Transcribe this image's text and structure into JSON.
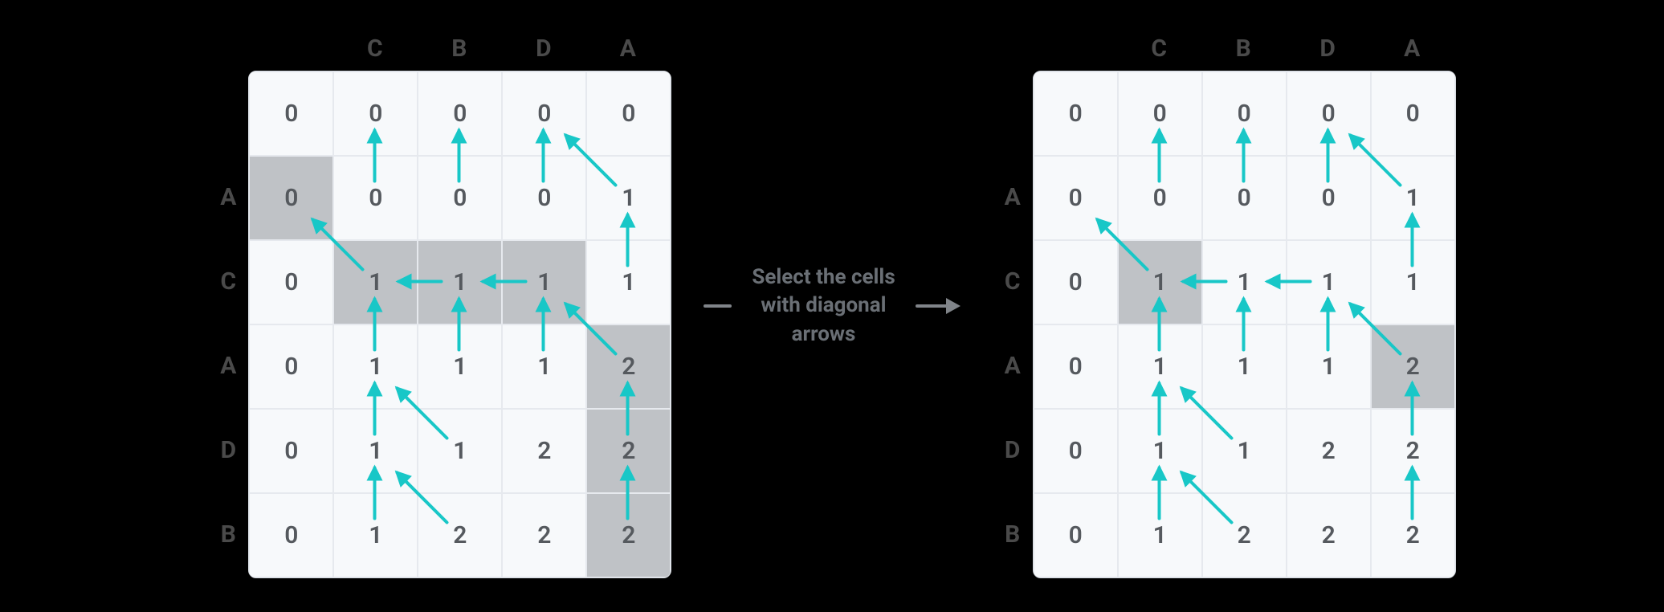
{
  "colHeaders": [
    "",
    "C",
    "B",
    "D",
    "A"
  ],
  "rowHeaders": [
    "",
    "A",
    "C",
    "A",
    "D",
    "B"
  ],
  "arrowColor": "#18c7c7",
  "middle": {
    "line1": "Select the cells",
    "line2": "with diagonal",
    "line3": "arrows"
  },
  "left": {
    "cells": [
      [
        {
          "v": "0"
        },
        {
          "v": "0"
        },
        {
          "v": "0"
        },
        {
          "v": "0"
        },
        {
          "v": "0"
        }
      ],
      [
        {
          "v": "0",
          "hl": true
        },
        {
          "v": "0"
        },
        {
          "v": "0"
        },
        {
          "v": "0"
        },
        {
          "v": "1"
        }
      ],
      [
        {
          "v": "0"
        },
        {
          "v": "1",
          "hl": true
        },
        {
          "v": "1",
          "hl": true
        },
        {
          "v": "1",
          "hl": true
        },
        {
          "v": "1"
        }
      ],
      [
        {
          "v": "0"
        },
        {
          "v": "1"
        },
        {
          "v": "1"
        },
        {
          "v": "1"
        },
        {
          "v": "2",
          "hl": true
        }
      ],
      [
        {
          "v": "0"
        },
        {
          "v": "1"
        },
        {
          "v": "1"
        },
        {
          "v": "2"
        },
        {
          "v": "2",
          "hl": true
        }
      ],
      [
        {
          "v": "0"
        },
        {
          "v": "1"
        },
        {
          "v": "2"
        },
        {
          "v": "2"
        },
        {
          "v": "2",
          "hl": true
        }
      ]
    ],
    "arrows": [
      {
        "type": "up",
        "r": 1,
        "c": 1
      },
      {
        "type": "up",
        "r": 1,
        "c": 2
      },
      {
        "type": "up",
        "r": 1,
        "c": 3
      },
      {
        "type": "diag",
        "r": 1,
        "c": 4
      },
      {
        "type": "diag",
        "r": 2,
        "c": 1
      },
      {
        "type": "left",
        "r": 2,
        "c": 2
      },
      {
        "type": "left",
        "r": 2,
        "c": 3
      },
      {
        "type": "up",
        "r": 2,
        "c": 4
      },
      {
        "type": "up",
        "r": 3,
        "c": 1
      },
      {
        "type": "up",
        "r": 3,
        "c": 2
      },
      {
        "type": "up",
        "r": 3,
        "c": 3
      },
      {
        "type": "diag",
        "r": 3,
        "c": 4
      },
      {
        "type": "up",
        "r": 4,
        "c": 1
      },
      {
        "type": "diag",
        "r": 4,
        "c": 2
      },
      {
        "type": "up",
        "r": 4,
        "c": 4
      },
      {
        "type": "up",
        "r": 5,
        "c": 1
      },
      {
        "type": "diag",
        "r": 5,
        "c": 2
      },
      {
        "type": "up",
        "r": 5,
        "c": 4
      }
    ]
  },
  "right": {
    "cells": [
      [
        {
          "v": "0"
        },
        {
          "v": "0"
        },
        {
          "v": "0"
        },
        {
          "v": "0"
        },
        {
          "v": "0"
        }
      ],
      [
        {
          "v": "0"
        },
        {
          "v": "0"
        },
        {
          "v": "0"
        },
        {
          "v": "0"
        },
        {
          "v": "1"
        }
      ],
      [
        {
          "v": "0"
        },
        {
          "v": "1",
          "hl": true
        },
        {
          "v": "1"
        },
        {
          "v": "1"
        },
        {
          "v": "1"
        }
      ],
      [
        {
          "v": "0"
        },
        {
          "v": "1"
        },
        {
          "v": "1"
        },
        {
          "v": "1"
        },
        {
          "v": "2",
          "hl": true
        }
      ],
      [
        {
          "v": "0"
        },
        {
          "v": "1"
        },
        {
          "v": "1"
        },
        {
          "v": "2"
        },
        {
          "v": "2"
        }
      ],
      [
        {
          "v": "0"
        },
        {
          "v": "1"
        },
        {
          "v": "2"
        },
        {
          "v": "2"
        },
        {
          "v": "2"
        }
      ]
    ],
    "arrows": [
      {
        "type": "up",
        "r": 1,
        "c": 1
      },
      {
        "type": "up",
        "r": 1,
        "c": 2
      },
      {
        "type": "up",
        "r": 1,
        "c": 3
      },
      {
        "type": "diag",
        "r": 1,
        "c": 4
      },
      {
        "type": "diag",
        "r": 2,
        "c": 1
      },
      {
        "type": "left",
        "r": 2,
        "c": 2
      },
      {
        "type": "left",
        "r": 2,
        "c": 3
      },
      {
        "type": "up",
        "r": 2,
        "c": 4
      },
      {
        "type": "up",
        "r": 3,
        "c": 1
      },
      {
        "type": "up",
        "r": 3,
        "c": 2
      },
      {
        "type": "up",
        "r": 3,
        "c": 3
      },
      {
        "type": "diag",
        "r": 3,
        "c": 4
      },
      {
        "type": "up",
        "r": 4,
        "c": 1
      },
      {
        "type": "diag",
        "r": 4,
        "c": 2
      },
      {
        "type": "up",
        "r": 4,
        "c": 4
      },
      {
        "type": "up",
        "r": 5,
        "c": 1
      },
      {
        "type": "diag",
        "r": 5,
        "c": 2
      },
      {
        "type": "up",
        "r": 5,
        "c": 4
      }
    ]
  }
}
